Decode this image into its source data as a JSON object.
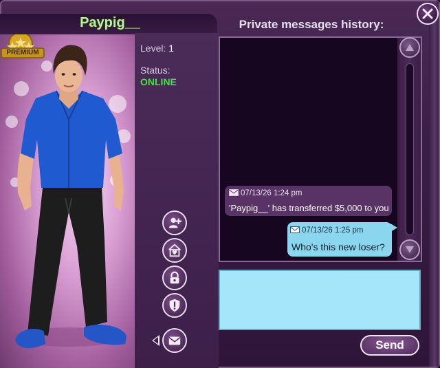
{
  "profile": {
    "username": "Paypig__",
    "badge": "PREMIUM",
    "level_label": "Level:",
    "level_value": "1",
    "status_label": "Status:",
    "status_value": "ONLINE"
  },
  "actions": [
    {
      "icon": "add-friend-icon"
    },
    {
      "icon": "home-heart-icon"
    },
    {
      "icon": "lock-icon"
    },
    {
      "icon": "report-shield-icon"
    },
    {
      "icon": "mail-icon"
    }
  ],
  "messages": {
    "title": "Private messages history:",
    "items": [
      {
        "direction": "in",
        "timestamp": "07/13/26  1:24 pm",
        "text": "'Paypig__' has transferred $5,000 to you"
      },
      {
        "direction": "out",
        "timestamp": "07/13/26  1:25 pm",
        "text": "Who's this new loser?"
      }
    ]
  },
  "compose": {
    "value": "",
    "send_label": "Send"
  },
  "colors": {
    "username": "#b8f59a",
    "online": "#3ee63e",
    "outgoing_bubble": "#8bd6ef",
    "incoming_bubble": "#5a3366",
    "compose_bg": "#a6e6fb"
  }
}
